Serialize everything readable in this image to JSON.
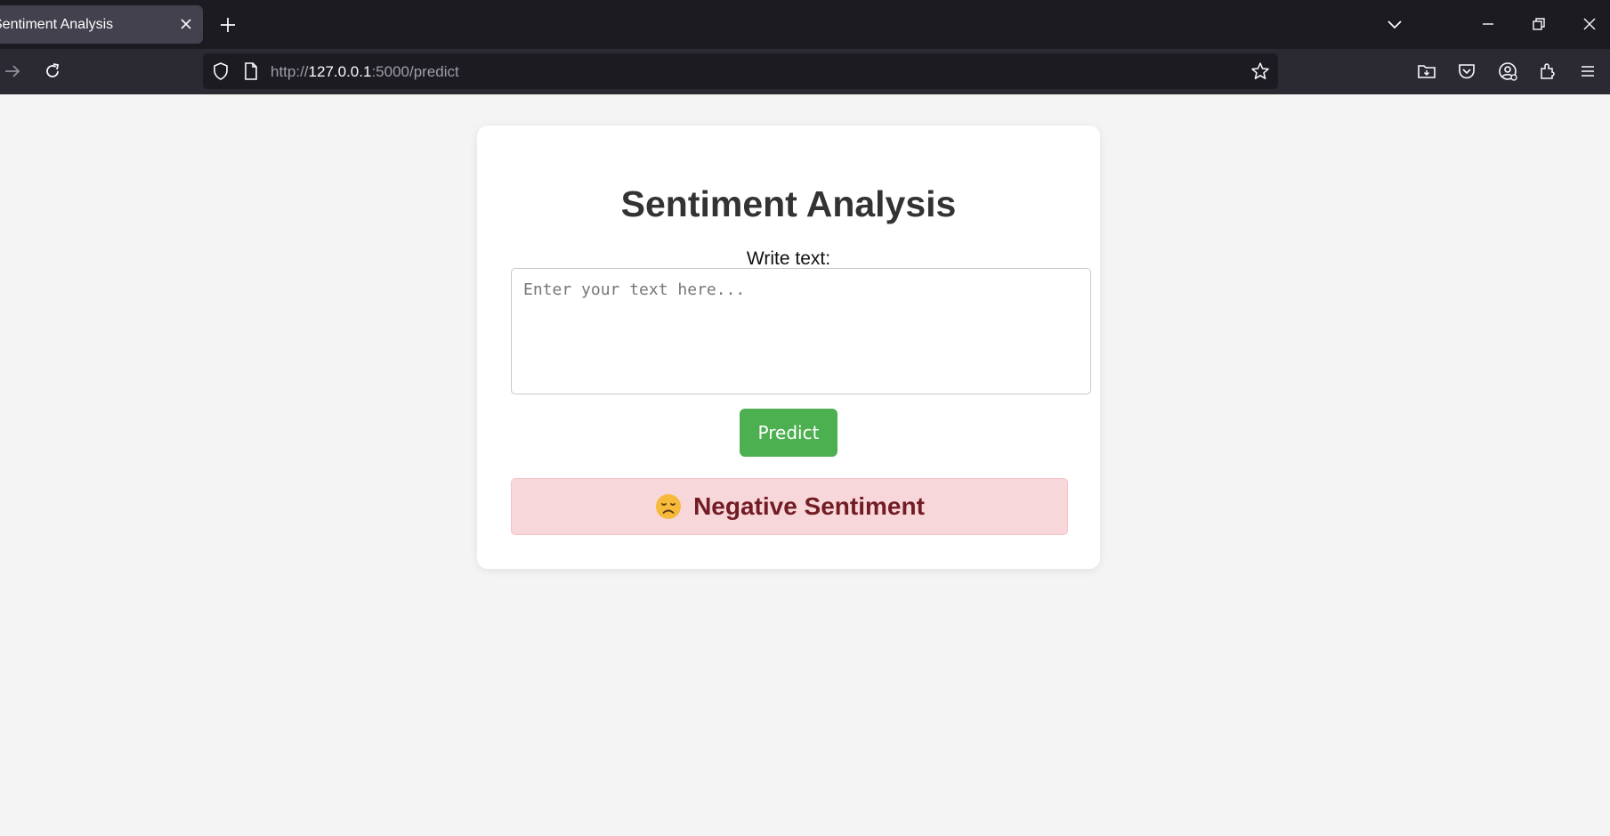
{
  "browser": {
    "tab_title": "Sentiment Analysis",
    "url_prefix": "http://",
    "url_host": "127.0.0.1",
    "url_rest": ":5000/predict"
  },
  "page": {
    "title": "Sentiment Analysis",
    "input_label": "Write text:",
    "input_placeholder": "Enter your text here...",
    "input_value": "",
    "predict_label": "Predict",
    "result_text": "Negative Sentiment",
    "result_emoji": "disappointed-face-icon"
  },
  "colors": {
    "button": "#4caf50",
    "result_bg": "#f8d7da",
    "result_text": "#721c24"
  }
}
